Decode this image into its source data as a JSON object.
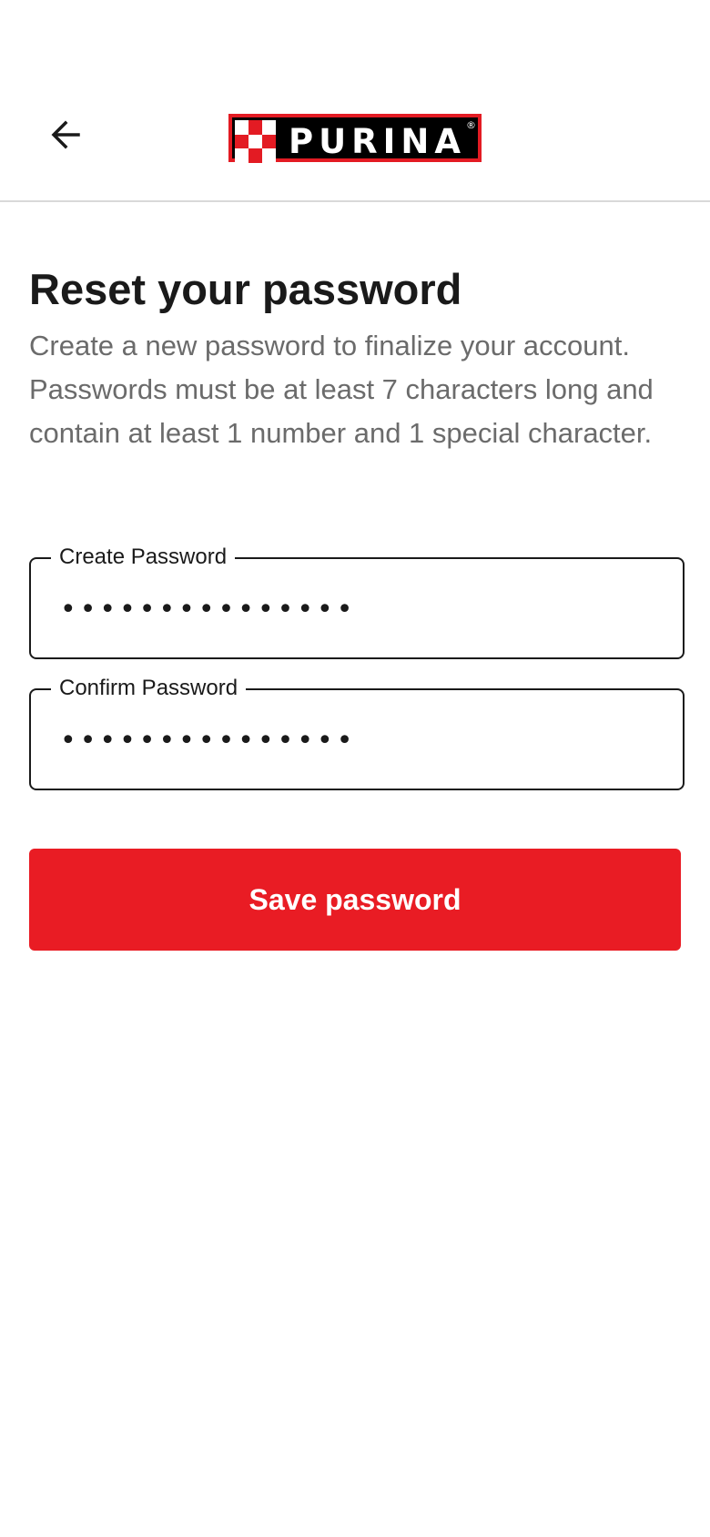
{
  "header": {
    "back_icon": "arrow-left-icon",
    "logo_text": "PURINA",
    "logo_reg": "®",
    "brand_colors": {
      "red": "#e31b23",
      "black": "#000000"
    }
  },
  "main": {
    "title": "Reset your password",
    "description": "Create a new password to finalize your account. Passwords must be at least 7 characters long and contain at least 1 number and 1 special character.",
    "fields": [
      {
        "label": "Create Password",
        "value": "•••••••••••••••",
        "type": "password"
      },
      {
        "label": "Confirm Password",
        "value": "•••••••••••••••",
        "type": "password"
      }
    ],
    "save_label": "Save password",
    "accent_color": "#e91c24"
  }
}
